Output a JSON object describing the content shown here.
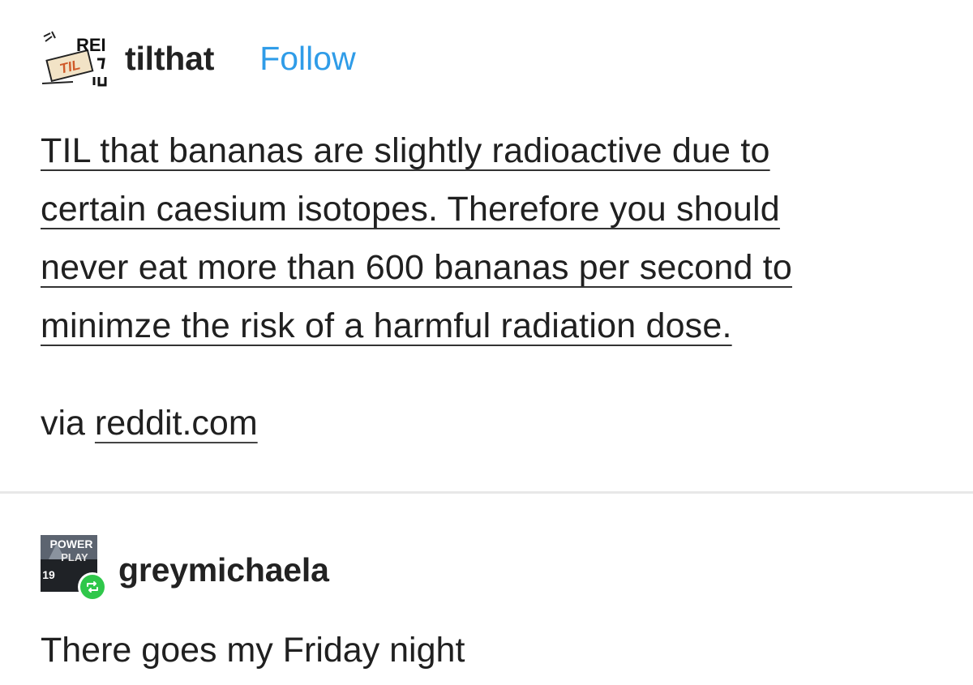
{
  "post1": {
    "username": "tilthat",
    "follow_label": "Follow",
    "avatar": {
      "icon": "til-reddit-avatar",
      "text_top": "REI",
      "text_badge": "TIL"
    },
    "body_lines": [
      "TIL that bananas are slightly radioactive due to",
      "certain caesium isotopes. Therefore you should",
      "never eat more than 600 bananas per second to",
      "minimze the risk of a harmful radiation dose."
    ],
    "via_prefix": "via",
    "via_link": "reddit.com"
  },
  "post2": {
    "username": "greymichaela",
    "avatar": {
      "icon": "power-play-avatar",
      "text_top": "POWER",
      "text_mid": "PLAY",
      "text_num": "19"
    },
    "reblog_icon": "reblog-icon",
    "reblog_color": "#2fc74a",
    "text": "There goes my Friday night"
  },
  "colors": {
    "follow": "#2f9ce8",
    "text": "#202020"
  }
}
